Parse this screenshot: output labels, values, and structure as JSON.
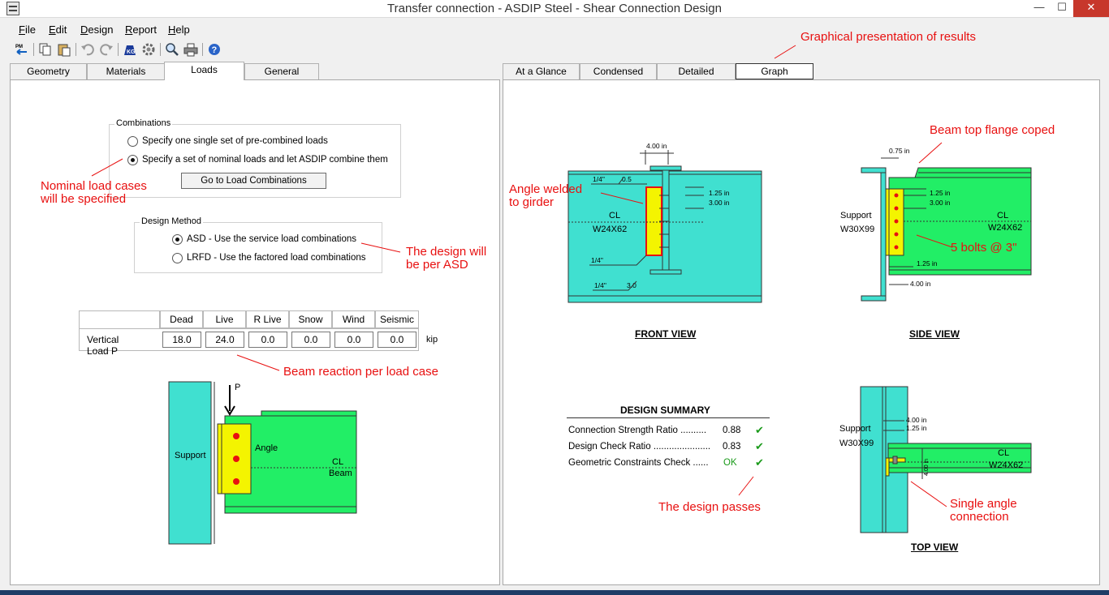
{
  "window": {
    "title": "Transfer connection - ASDIP Steel - Shear Connection Design",
    "min_glyph": "—",
    "max_glyph": "☐",
    "close_glyph": "✕"
  },
  "menu": [
    {
      "key": "F",
      "rest": "ile"
    },
    {
      "key": "E",
      "rest": "dit"
    },
    {
      "key": "D",
      "rest": "esign"
    },
    {
      "key": "R",
      "rest": "eport"
    },
    {
      "key": "H",
      "rest": "elp"
    }
  ],
  "toolbar": {
    "icons": [
      "pm-back-icon",
      "copy-icon",
      "paste-icon",
      "undo-icon",
      "redo-icon",
      "kg-units-icon",
      "settings-icon",
      "preview-icon",
      "print-icon",
      "help-icon"
    ],
    "pm_label": "PM",
    "kg_label": "KG"
  },
  "left_tabs": [
    "Geometry",
    "Materials",
    "Loads",
    "General"
  ],
  "right_tabs": [
    "At a Glance",
    "Condensed",
    "Detailed",
    "Graph"
  ],
  "combinations": {
    "title": "Combinations",
    "option1": "Specify one single set of pre-combined loads",
    "option2": "Specify a set of nominal loads and let ASDIP combine them",
    "button": "Go to Load Combinations"
  },
  "design_method": {
    "title": "Design Method",
    "option1": "ASD - Use the service load combinations",
    "option2": "LRFD - Use the factored load combinations"
  },
  "loads": {
    "headers": [
      "Dead",
      "Live",
      "R Live",
      "Snow",
      "Wind",
      "Seismic"
    ],
    "row_label": "Vertical Load  P",
    "values": [
      "18.0",
      "24.0",
      "0.0",
      "0.0",
      "0.0",
      "0.0"
    ],
    "unit": "kip"
  },
  "annotations": {
    "graph": "Graphical presentation of results",
    "nominal1": "Nominal load cases",
    "nominal2": "will be specified",
    "asd1": "The design will",
    "asd2": "be per ASD",
    "reaction": "Beam reaction per load case",
    "angle1": "Angle welded",
    "angle2": "to girder",
    "coped": "Beam top flange coped",
    "bolts": "5 bolts @ 3\"",
    "passes": "The design passes",
    "single1": "Single angle",
    "single2": "connection"
  },
  "load_diagram": {
    "support": "Support",
    "p": "P",
    "angle": "Angle",
    "cl": "CL",
    "beam": "Beam"
  },
  "front_view": {
    "title": "FRONT VIEW",
    "dim_top": "4.00 in",
    "weld1": "1/4\"",
    "weld1b": "0.5",
    "d1": "1.25 in",
    "d2": "3.00 in",
    "cl": "CL",
    "section": "W24X62",
    "weld2": "1/4\"",
    "weld3": "1/4\"",
    "weld3b": "3.0"
  },
  "side_view": {
    "title": "SIDE VIEW",
    "cope": "0.75 in",
    "d1": "1.25 in",
    "d2": "3.00 in",
    "support": "Support",
    "support_section": "W30X99",
    "cl": "CL",
    "section": "W24X62",
    "d3": "1.25 in",
    "d4": "4.00 in"
  },
  "top_view": {
    "title": "TOP VIEW",
    "d1": "4.00 in",
    "d2": "1.25 in",
    "support": "Support",
    "support_section": "W30X99",
    "cl": "CL",
    "section": "W24X62",
    "d3": "4.00 in"
  },
  "summary": {
    "title": "DESIGN SUMMARY",
    "rows": [
      {
        "label": "Connection Strength Ratio  ..........",
        "value": "0.88"
      },
      {
        "label": "Design Check Ratio ......................",
        "value": "0.83"
      },
      {
        "label": "Geometric Constraints Check  ......",
        "value": "OK"
      }
    ],
    "check": "✔"
  },
  "colors": {
    "cyan": "#40e0d0",
    "green": "#22ee66",
    "yellow": "#f4f400",
    "red": "#e81010",
    "check": "#1a9a1a"
  }
}
